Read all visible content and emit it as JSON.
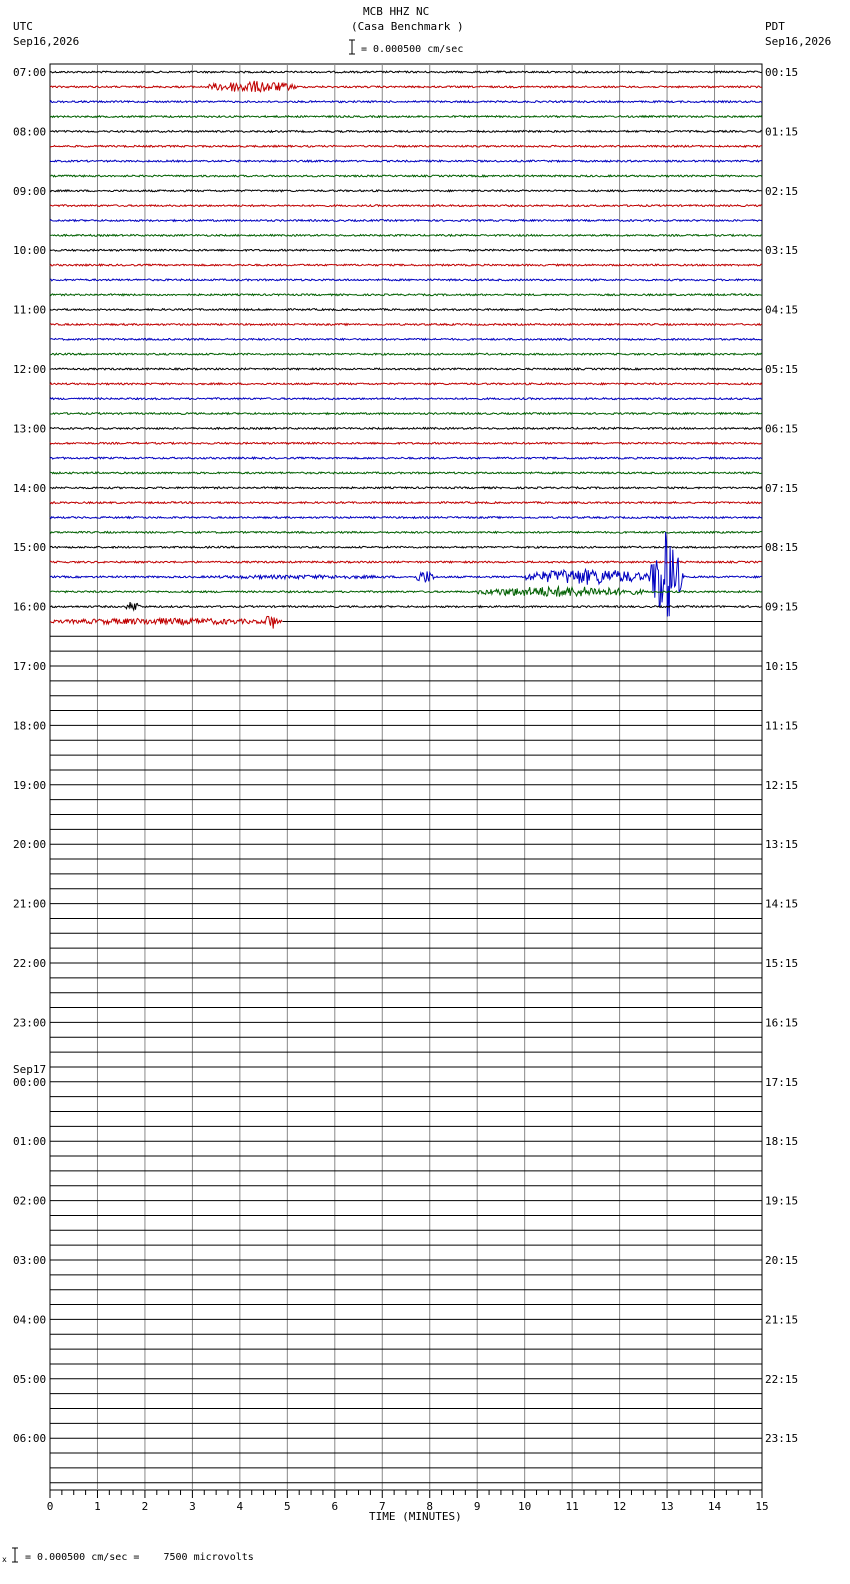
{
  "header": {
    "title": "MCB HHZ NC",
    "subtitle": "(Casa Benchmark )",
    "scale_label": "= 0.000500 cm/sec",
    "left_tz": "UTC",
    "left_date": "Sep16,2026",
    "right_tz": "PDT",
    "right_date": "Sep16,2026"
  },
  "footer": {
    "scale_note": "= 0.000500 cm/sec =    7500 microvolts"
  },
  "chart_data": {
    "type": "line",
    "title": "MCB HHZ NC",
    "xlabel": "TIME (MINUTES)",
    "xlim": [
      0,
      15
    ],
    "x_ticks": [
      "0",
      "1",
      "2",
      "3",
      "4",
      "5",
      "6",
      "7",
      "8",
      "9",
      "10",
      "11",
      "12",
      "13",
      "14",
      "15"
    ],
    "trace_minutes": 15,
    "total_traces": 96,
    "recorded_traces": 38,
    "trace_colors": [
      "#000000",
      "#c00000",
      "#0000c0",
      "#006000"
    ],
    "grid": true,
    "left_labels": [
      {
        "row": 0,
        "text": "07:00"
      },
      {
        "row": 4,
        "text": "08:00"
      },
      {
        "row": 8,
        "text": "09:00"
      },
      {
        "row": 12,
        "text": "10:00"
      },
      {
        "row": 16,
        "text": "11:00"
      },
      {
        "row": 20,
        "text": "12:00"
      },
      {
        "row": 24,
        "text": "13:00"
      },
      {
        "row": 28,
        "text": "14:00"
      },
      {
        "row": 32,
        "text": "15:00"
      },
      {
        "row": 36,
        "text": "16:00"
      },
      {
        "row": 40,
        "text": "17:00"
      },
      {
        "row": 44,
        "text": "18:00"
      },
      {
        "row": 48,
        "text": "19:00"
      },
      {
        "row": 52,
        "text": "20:00"
      },
      {
        "row": 56,
        "text": "21:00"
      },
      {
        "row": 60,
        "text": "22:00"
      },
      {
        "row": 64,
        "text": "23:00"
      },
      {
        "row": 68,
        "text": "00:00",
        "date": "Sep17"
      },
      {
        "row": 72,
        "text": "01:00"
      },
      {
        "row": 76,
        "text": "02:00"
      },
      {
        "row": 80,
        "text": "03:00"
      },
      {
        "row": 84,
        "text": "04:00"
      },
      {
        "row": 88,
        "text": "05:00"
      },
      {
        "row": 92,
        "text": "06:00"
      }
    ],
    "right_labels": [
      {
        "row": 0,
        "text": "00:15"
      },
      {
        "row": 4,
        "text": "01:15"
      },
      {
        "row": 8,
        "text": "02:15"
      },
      {
        "row": 12,
        "text": "03:15"
      },
      {
        "row": 16,
        "text": "04:15"
      },
      {
        "row": 20,
        "text": "05:15"
      },
      {
        "row": 24,
        "text": "06:15"
      },
      {
        "row": 28,
        "text": "07:15"
      },
      {
        "row": 32,
        "text": "08:15"
      },
      {
        "row": 36,
        "text": "09:15"
      },
      {
        "row": 40,
        "text": "10:15"
      },
      {
        "row": 44,
        "text": "11:15"
      },
      {
        "row": 48,
        "text": "12:15"
      },
      {
        "row": 52,
        "text": "13:15"
      },
      {
        "row": 56,
        "text": "14:15"
      },
      {
        "row": 60,
        "text": "15:15"
      },
      {
        "row": 64,
        "text": "16:15"
      },
      {
        "row": 68,
        "text": "17:15"
      },
      {
        "row": 72,
        "text": "18:15"
      },
      {
        "row": 76,
        "text": "19:15"
      },
      {
        "row": 80,
        "text": "20:15"
      },
      {
        "row": 84,
        "text": "21:15"
      },
      {
        "row": 88,
        "text": "22:15"
      },
      {
        "row": 92,
        "text": "23:15"
      }
    ],
    "events": [
      {
        "row": 1,
        "start_min": 3.3,
        "end_min": 5.2,
        "amplitude": 0.45
      },
      {
        "row": 34,
        "start_min": 3.0,
        "end_min": 7.5,
        "amplitude": 0.15
      },
      {
        "row": 34,
        "start_min": 7.7,
        "end_min": 8.1,
        "amplitude": 0.5
      },
      {
        "row": 34,
        "start_min": 10.0,
        "end_min": 12.6,
        "amplitude": 0.6
      },
      {
        "row": 34,
        "start_min": 12.6,
        "end_min": 13.5,
        "amplitude": 3.5
      },
      {
        "row": 35,
        "start_min": 9.0,
        "end_min": 12.5,
        "amplitude": 0.4
      },
      {
        "row": 36,
        "start_min": 1.6,
        "end_min": 1.9,
        "amplitude": 0.4
      },
      {
        "row": 37,
        "start_min": 0.0,
        "end_min": 4.9,
        "amplitude": 0.25
      },
      {
        "row": 37,
        "start_min": 4.5,
        "end_min": 4.8,
        "amplitude": 0.6
      }
    ]
  }
}
